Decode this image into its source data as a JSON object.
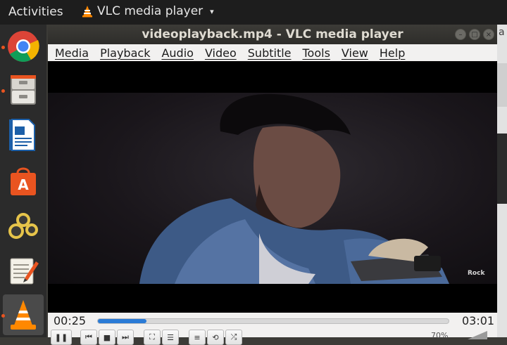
{
  "topbar": {
    "activities_label": "Activities",
    "app_name": "VLC media player"
  },
  "dock": {
    "items": [
      {
        "name": "chrome",
        "running": true
      },
      {
        "name": "files-cabinet",
        "running": true
      },
      {
        "name": "libreoffice-writer",
        "running": false
      },
      {
        "name": "software-center",
        "running": false
      },
      {
        "name": "settings-gears",
        "running": false
      },
      {
        "name": "text-editor",
        "running": false
      },
      {
        "name": "vlc",
        "running": true,
        "active": true
      }
    ]
  },
  "window": {
    "title": "videoplayback.mp4 - VLC media player"
  },
  "menu": [
    "Media",
    "Playback",
    "Audio",
    "Video",
    "Subtitle",
    "Tools",
    "View",
    "Help"
  ],
  "video": {
    "watermark": "Rock"
  },
  "playback": {
    "elapsed": "00:25",
    "total": "03:01",
    "progress": 0.138,
    "volume_label": "70%"
  },
  "colors": {
    "accent": "#2b7bd6",
    "ubuntu_orange": "#e95420",
    "vlc_orange": "#ff8800"
  },
  "background_text": "a"
}
